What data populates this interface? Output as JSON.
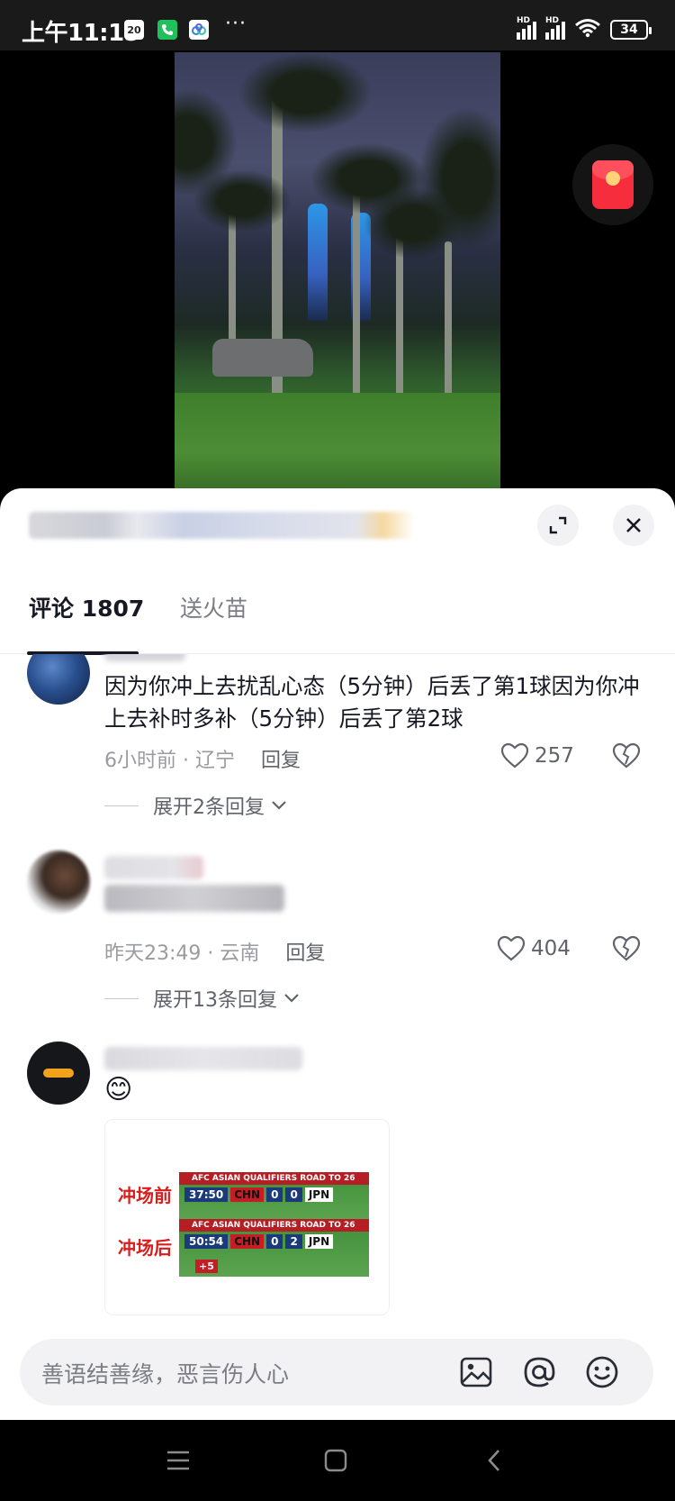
{
  "status_bar": {
    "time": "上午11:15",
    "calendar_badge": "20",
    "more": "···",
    "signal1_label": "HD",
    "signal2_label": "HD",
    "battery": "34"
  },
  "comments_header": {
    "tab_comments": "评论 1807",
    "tab_fire": "送火苗"
  },
  "comments": [
    {
      "text": "因为你冲上去扰乱心态（5分钟）后丢了第1球因为你冲上去补时多补（5分钟）后丢了第2球",
      "time": "6小时前",
      "location": "辽宁",
      "reply_label": "回复",
      "likes": "257",
      "expand": "展开2条回复"
    },
    {
      "time": "昨天23:49",
      "location": "云南",
      "reply_label": "回复",
      "likes": "404",
      "expand": "展开13条回复"
    },
    {
      "emoji": "😊",
      "image": {
        "label_before": "冲场前",
        "label_after": "冲场后",
        "board_title": "AFC ASIAN QUALIFIERS  ROAD TO 26",
        "before": {
          "time": "37:50",
          "home": "CHN",
          "home_score": "0",
          "away_score": "0",
          "away": "JPN"
        },
        "after": {
          "time": "50:54",
          "home": "CHN",
          "home_score": "0",
          "away_score": "2",
          "away": "JPN",
          "added": "+5"
        }
      }
    }
  ],
  "input": {
    "placeholder": "善语结善缘，恶言伤人心"
  },
  "colors": {
    "accent_red": "#f52d3c",
    "text_primary": "#161823",
    "text_secondary": "#9a9ba1"
  }
}
